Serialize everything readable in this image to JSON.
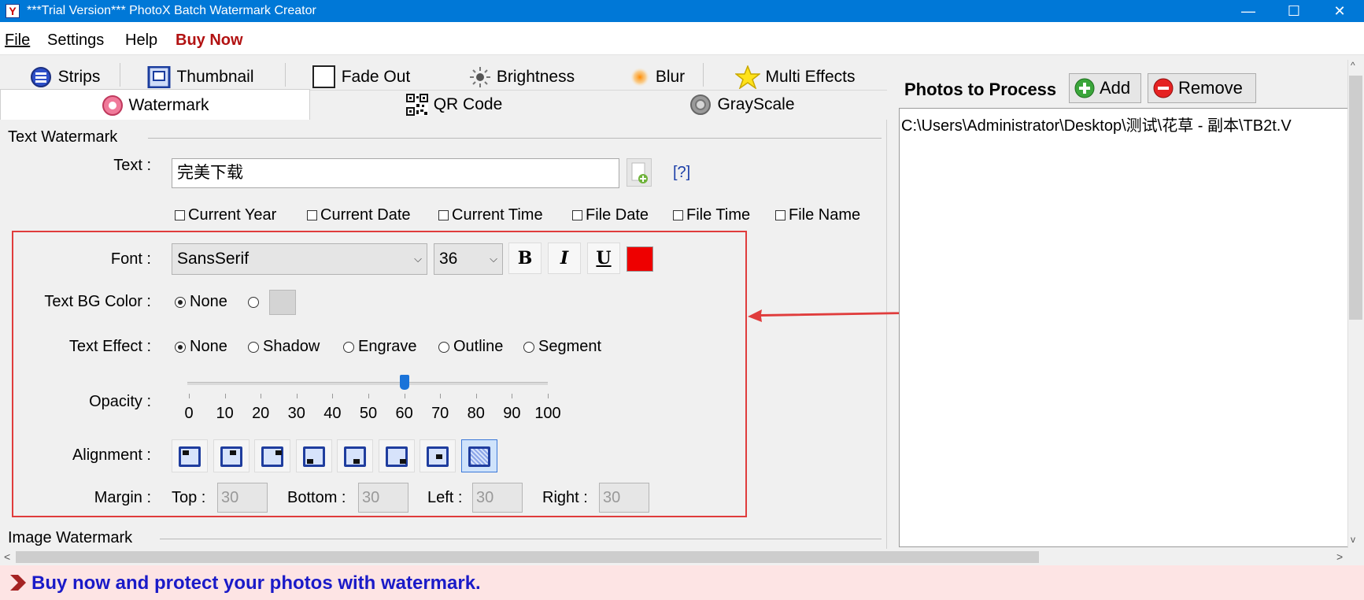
{
  "window": {
    "title": "***Trial Version*** PhotoX Batch Watermark Creator",
    "minimize_glyph": "—",
    "maximize_glyph": "☐",
    "close_glyph": "✕"
  },
  "menu": {
    "file": "File",
    "settings": "Settings",
    "help": "Help",
    "buy_now": "Buy Now"
  },
  "tabs": {
    "strips": "Strips",
    "thumbnail": "Thumbnail",
    "fade_out": "Fade Out",
    "brightness": "Brightness",
    "blur": "Blur",
    "multi_effects": "Multi Effects",
    "watermark": "Watermark",
    "qr_code": "QR Code",
    "grayscale": "GrayScale"
  },
  "text_watermark": {
    "section_title": "Text Watermark",
    "text_label": "Text :",
    "text_value": "完美下载",
    "help_link": "[?]",
    "options": {
      "current_year": "Current Year",
      "current_date": "Current Date",
      "current_time": "Current Time",
      "file_date": "File Date",
      "file_time": "File Time",
      "file_name": "File Name"
    },
    "font_label": "Font :",
    "font_value": "SansSerif",
    "size_value": "36",
    "bold_glyph": "B",
    "italic_glyph": "I",
    "underline_glyph": "U",
    "font_color": "#ee0000",
    "bg_color_label": "Text BG Color :",
    "bg_none": "None",
    "bg_swatch_color": "#d4d4d4",
    "effect_label": "Text Effect  :",
    "effects": {
      "none": "None",
      "shadow": "Shadow",
      "engrave": "Engrave",
      "outline": "Outline",
      "segment": "Segment"
    },
    "opacity_label": "Opacity :",
    "opacity_value": 60,
    "opacity_ticks": [
      "0",
      "10",
      "20",
      "30",
      "40",
      "50",
      "60",
      "70",
      "80",
      "90",
      "100"
    ],
    "alignment_label": "Alignment :",
    "alignment_selected_index": 7,
    "margin_label": "Margin :",
    "margin_top_label": "Top :",
    "margin_top": "30",
    "margin_bottom_label": "Bottom :",
    "margin_bottom": "30",
    "margin_left_label": "Left :",
    "margin_left": "30",
    "margin_right_label": "Right :",
    "margin_right": "30"
  },
  "image_watermark": {
    "section_title": "Image Watermark"
  },
  "photos": {
    "title": "Photos to Process",
    "add_label": "Add",
    "remove_label": "Remove",
    "items": [
      "C:\\Users\\Administrator\\Desktop\\测试\\花草 - 副本\\TB2t.V"
    ]
  },
  "footer": {
    "message": "Buy now and protect your photos with watermark."
  },
  "scroll": {
    "left_arrow": "<",
    "right_arrow": ">",
    "up_arrow": "^",
    "down_arrow": "v"
  },
  "colors": {
    "title_bar": "#0078d7",
    "highlight": "#e03c3c",
    "footer_text": "#1a1ac8",
    "buy_now": "#b21212"
  }
}
